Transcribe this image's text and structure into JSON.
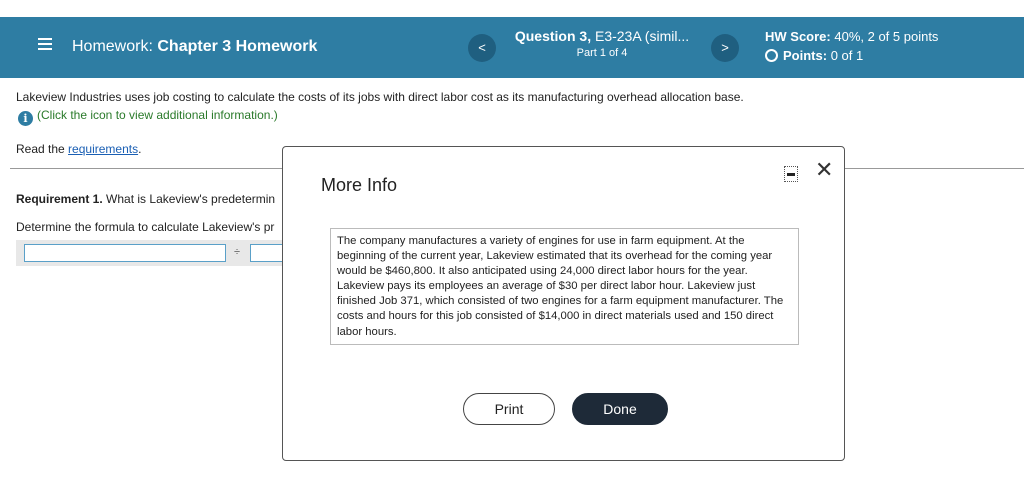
{
  "header": {
    "menu_icon": "hamburger-icon",
    "hw_prefix": "Homework:",
    "hw_name": "Chapter 3 Homework",
    "prev_icon": "<",
    "next_icon": ">",
    "question_label": "Question 3,",
    "question_name": "E3-23A (simil...",
    "part": "Part 1 of 4",
    "score_label": "HW Score:",
    "score_value": "40%, 2 of 5 points",
    "points_label": "Points:",
    "points_value": "0 of 1",
    "bar_color": "#2e7da3"
  },
  "content": {
    "intro": "Lakeview Industries uses job costing to calculate the costs of its jobs with direct labor cost as its manufacturing overhead allocation base.",
    "info_icon": "i",
    "info_link": "(Click the icon to view additional information.)",
    "read_prefix": "Read the",
    "read_link": "requirements",
    "read_suffix": ".",
    "req_label": "Requirement 1.",
    "req_text": "What is Lakeview's predetermin",
    "determine_text": "Determine the formula to calculate Lakeview's pr",
    "divide_symbol": "÷"
  },
  "modal": {
    "title": "More Info",
    "body": "The company manufactures a variety of engines for use in farm equipment. At the beginning of the current year, Lakeview estimated that its overhead for the coming year would be $460,800. It also anticipated using 24,000 direct labor hours for the year. Lakeview pays its employees an average of $30 per direct labor hour. Lakeview just finished Job 371, which consisted of two engines for a farm equipment manufacturer. The costs and hours for this job consisted of $14,000 in direct materials used and 150 direct labor hours.",
    "close_symbol": "✕",
    "print_label": "Print",
    "done_label": "Done"
  }
}
